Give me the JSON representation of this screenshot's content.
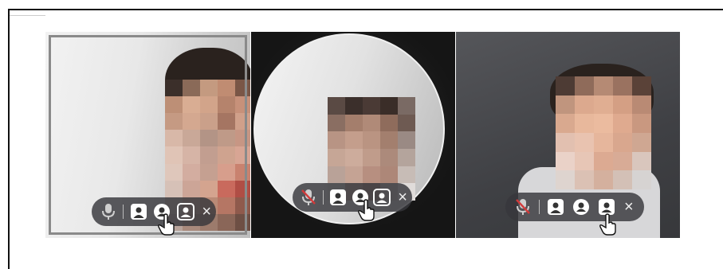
{
  "panels": [
    {
      "name": "square-view",
      "close_glyph": "×"
    },
    {
      "name": "circle-view",
      "close_glyph": "×"
    },
    {
      "name": "cutout-view",
      "close_glyph": "×"
    }
  ],
  "icons": {
    "mic": "microphone-icon",
    "person_square": "person-square-icon",
    "person_circle": "person-circle-icon",
    "person_cutout": "person-cutout-icon",
    "close": "close-icon",
    "cursor": "hand-cursor-icon"
  },
  "colors": {
    "toolbar_bg": "#37373c",
    "mic_off": "#d23a3a",
    "icon": "#ffffff"
  }
}
